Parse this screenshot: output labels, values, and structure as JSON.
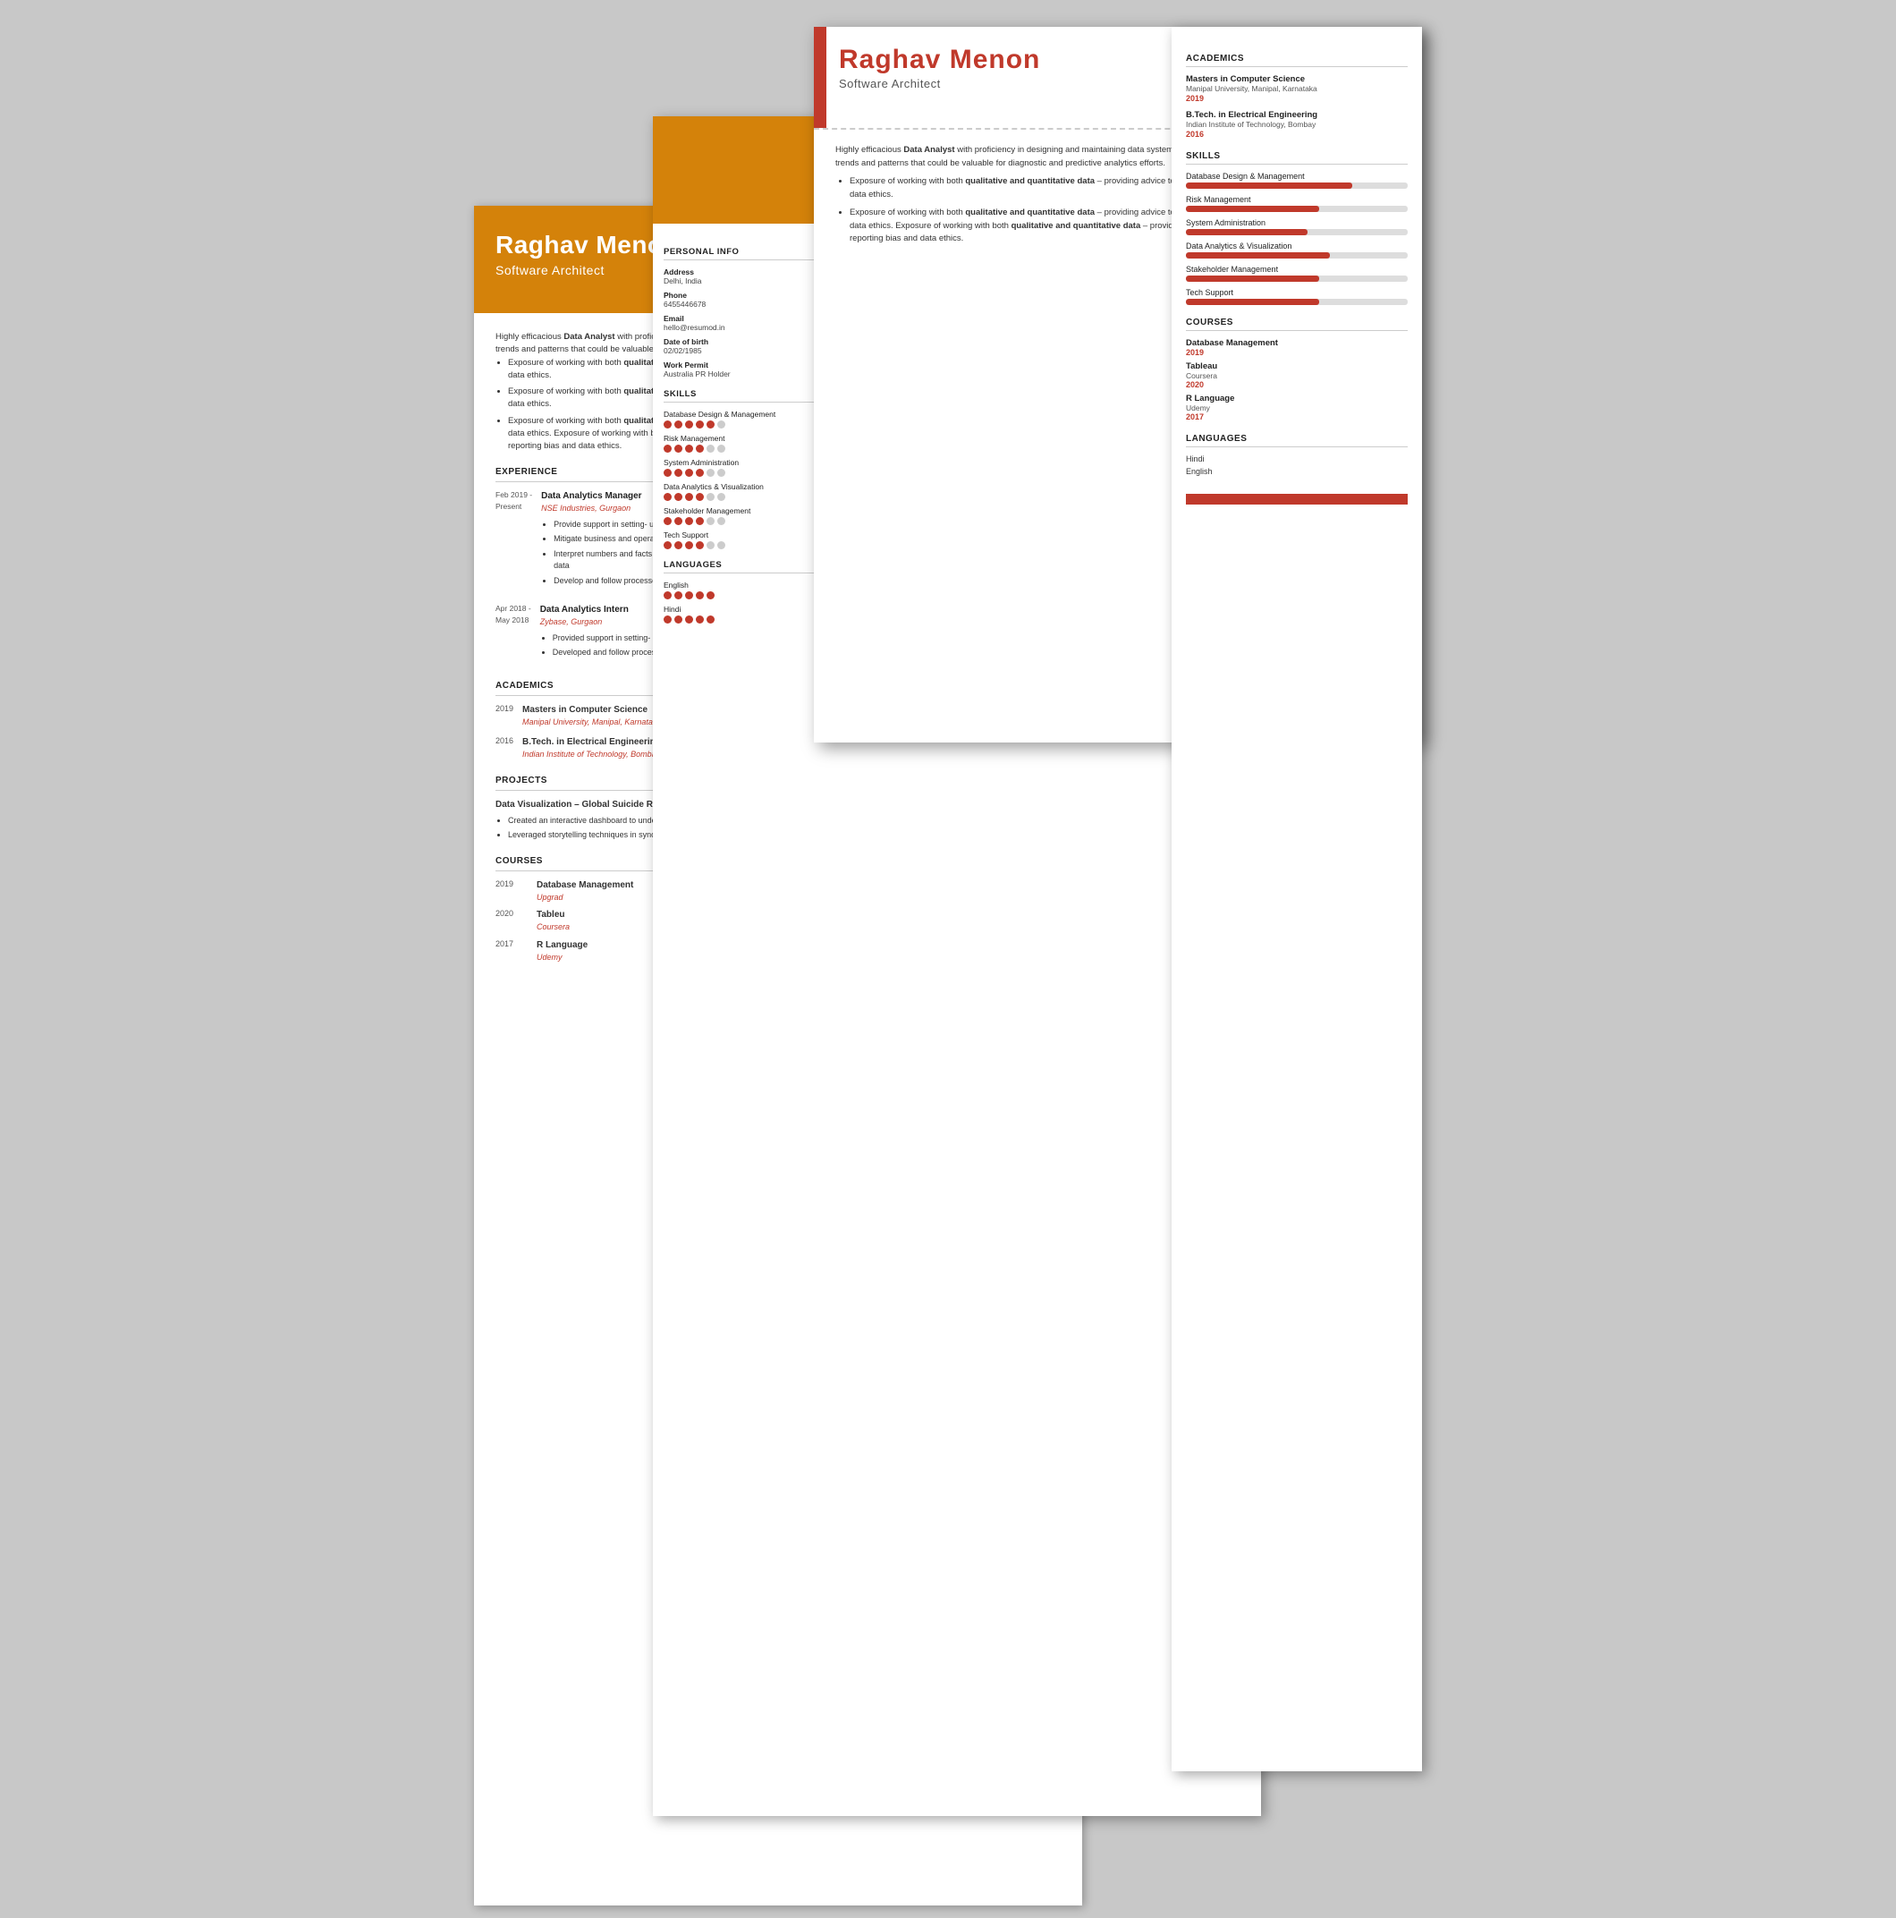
{
  "person": {
    "name": "Raghav Menon",
    "title": "Software Architect",
    "phone": "6455446678",
    "email": "hello@resumod.in",
    "location": "Delhi",
    "dob": "02/02/1985",
    "linkedin": "https://www.linkedin.com/in/praveen-b-tyagi-19b80032/",
    "work_permit": "Australia PR Holder"
  },
  "summary": {
    "text": "Highly efficacious Data Analyst with proficiency in designing and maintaining data systems, leveraging statistical tools to interpret data sets, to derive trends and patterns that could be valuable for diagnostic and predictive analytics efforts.",
    "bullets": [
      "Exposure of working with both qualitative and quantitative data – providing advice to teams on data collection pro and cons, reporting bias and data ethics.",
      "Exposure of working with both qualitative and quantitative data – providing advice to teams on data collection pro and cons, reporting bias and data ethics. Exposure of working with both qualitative and quantitative data – providing advice to teams on data collection pro and cons, reporting bias and data ethics."
    ]
  },
  "experience": [
    {
      "date_start": "Feb 2019 -",
      "date_end": "Present",
      "role": "Data Analytics Manager",
      "company": "NSE Industries, Gurgaon",
      "bullets": [
        "Provide support in setting- up the data platform and developing ML algorithms to optimize operations.",
        "Mitigate business and operational risks; perform data analysis, reporting, and documentation.",
        "Interpret numbers and facts to facilitate in strategic business decisions; investigating sales figures, market research, logistics, and cascading data",
        "Develop and follow processes to keep data confidential ; brainstorming solutions for costly business problems"
      ]
    },
    {
      "date_start": "Apr 2018 -",
      "date_end": "May 2018",
      "role": "Data Analytics Intern",
      "company": "Zybase, Gurgaon",
      "bullets": [
        "Provided support in setting- up the data platform and developing ML algorithms to optimize operations",
        "Developed and follow processes to keep data confidential; brainstorming solutions for costly business problems"
      ]
    }
  ],
  "academics": [
    {
      "year": "2019",
      "degree": "Masters in Computer Science",
      "school": "Manipal University, Manipal, Karnataka"
    },
    {
      "year": "2016",
      "degree": "B.Tech. in Electrical Engineering",
      "school": "Indian Institute of Technology, Bombay"
    }
  ],
  "projects": [
    {
      "title": "Data Visualization – Global Suicide Rates",
      "bullets": [
        "Created an interactive dashboard to understand various factors and their impacts through the years",
        "Leveraged storytelling techniques in sync with multiple data visualisation elements to increase awareness among users"
      ]
    }
  ],
  "courses": [
    {
      "year": "2019",
      "name": "Database Management",
      "provider": "Upgrad"
    },
    {
      "year": "2020",
      "name": "Tableu",
      "provider": "Coursera"
    },
    {
      "year": "2017",
      "name": "R Language",
      "provider": "Udemy"
    }
  ],
  "skills": [
    {
      "name": "Database Design & Management",
      "level": 75
    },
    {
      "name": "Risk Management",
      "level": 60
    },
    {
      "name": "System Administration",
      "level": 55
    },
    {
      "name": "Data Analytics & Visualization",
      "level": 65
    },
    {
      "name": "Stakeholder Management",
      "level": 60
    },
    {
      "name": "Tech Support",
      "level": 60
    }
  ],
  "skills_dots": [
    {
      "name": "Database Design & Management",
      "filled": 5,
      "total": 6
    },
    {
      "name": "Risk Management",
      "filled": 4,
      "total": 6
    },
    {
      "name": "System Administration",
      "filled": 4,
      "total": 6
    },
    {
      "name": "Data Analytics & Visualization",
      "filled": 4,
      "total": 6
    },
    {
      "name": "Stakeholder Management",
      "filled": 4,
      "total": 6
    },
    {
      "name": "Tech Support",
      "filled": 4,
      "total": 6
    }
  ],
  "languages": [
    {
      "name": "English",
      "filled": 5,
      "total": 5
    },
    {
      "name": "Hindi",
      "filled": 5,
      "total": 5
    }
  ],
  "languages_simple": [
    "Hindi",
    "English"
  ],
  "labels": {
    "experience": "EXPERIENCE",
    "academics": "ACADEMICS",
    "projects": "PROJECTS",
    "courses": "COURSES",
    "skills": "SKILLS",
    "languages": "LANGUAGES",
    "personal_info": "PERSONAL INFO",
    "address_label": "Address",
    "phone_label": "Phone",
    "email_label": "Email",
    "dob_label": "Date of birth",
    "work_permit_label": "Work Permit"
  }
}
